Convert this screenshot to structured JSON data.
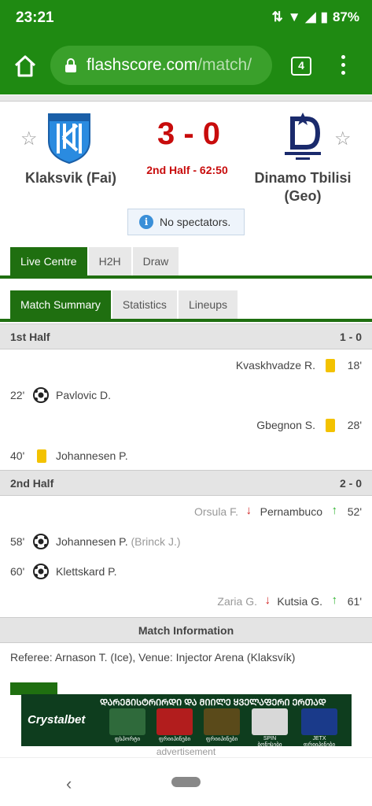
{
  "status_bar": {
    "time": "23:21",
    "battery": "87%"
  },
  "browser": {
    "url_domain": "flashscore.com",
    "url_path": "/match/",
    "tab_count": "4"
  },
  "match": {
    "home_team": "Klaksvik (Fai)",
    "away_team_line1": "Dinamo Tbilisi",
    "away_team_line2": "(Geo)",
    "score": "3 - 0",
    "status": "2nd Half - 62:50",
    "notice": "No spectators."
  },
  "main_tabs": [
    "Live Centre",
    "H2H",
    "Draw"
  ],
  "sub_tabs": [
    "Match Summary",
    "Statistics",
    "Lineups"
  ],
  "first_half": {
    "label": "1st Half",
    "score": "1 - 0",
    "events": [
      {
        "minute": "18'",
        "player": "Kvaskhvadze R."
      },
      {
        "minute": "22'",
        "player": "Pavlovic D."
      },
      {
        "minute": "28'",
        "player": "Gbegnon S."
      },
      {
        "minute": "40'",
        "player": "Johannesen P."
      }
    ]
  },
  "second_half": {
    "label": "2nd Half",
    "score": "2 - 0",
    "events": [
      {
        "minute": "52'",
        "player_out": "Orsula F.",
        "player_in": "Pernambuco"
      },
      {
        "minute": "58'",
        "player": "Johannesen P.",
        "assist": "(Brinck J.)"
      },
      {
        "minute": "60'",
        "player": "Klettskard P."
      },
      {
        "minute": "61'",
        "player_out": "Zaria G.",
        "player_in": "Kutsia G."
      }
    ]
  },
  "match_info": {
    "title": "Match Information",
    "referee_line": "Referee: Arnason T. (Ice), Venue: Injector Arena (Klaksvík)"
  },
  "ad": {
    "brand": "Crystalbet",
    "headline": "ᲓᲐᲠᲔᲒᲘᲡᲢᲠᲘᲠᲓᲘ ᲓᲐ ᲛᲘᲘᲚᲔ ᲧᲕᲔᲚᲐᲤᲔᲠᲘ ᲔᲠᲗᲐᲓ",
    "tiles": [
      "ფსპორტი",
      "ფრიიპინები",
      "ფრიიპინები",
      "SPIN ბონუსები",
      "JETX ფრიიპინები"
    ],
    "label": "advertisement"
  },
  "colors": {
    "brand_green": "#1f8a12",
    "tab_green": "#1f6f10",
    "score_red": "#c80c0c",
    "yellow_card": "#f3c200"
  }
}
